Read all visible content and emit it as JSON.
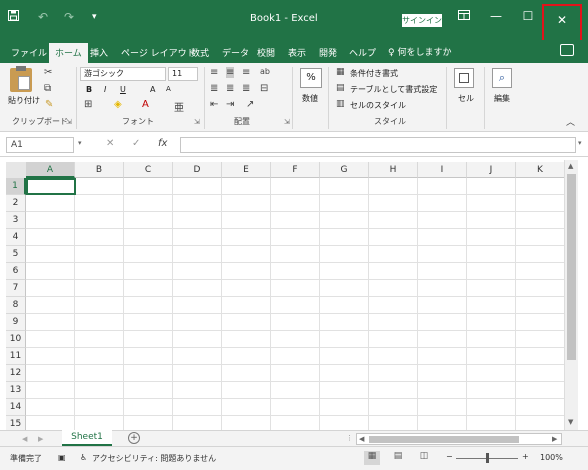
{
  "titlebar": {
    "title": "Book1  -  Excel",
    "signin": "サインイン",
    "save_icon": "save-icon",
    "undo_icon": "undo-icon",
    "redo_icon": "redo-icon",
    "customize_icon": "customize-qat-icon",
    "ribbon_display_icon": "ribbon-display-options-icon",
    "minimize": "—",
    "restore": "☐",
    "close": "✕"
  },
  "tabs": [
    {
      "label": "ファイル"
    },
    {
      "label": "ホーム"
    },
    {
      "label": "挿入"
    },
    {
      "label": "ページ レイアウト"
    },
    {
      "label": "数式"
    },
    {
      "label": "データ"
    },
    {
      "label": "校閲"
    },
    {
      "label": "表示"
    },
    {
      "label": "開発"
    },
    {
      "label": "ヘルプ"
    }
  ],
  "help_search": "何をしますか",
  "clipboard": {
    "paste": "貼り付け",
    "group": "クリップボード"
  },
  "font": {
    "name": "游ゴシック",
    "size": "11",
    "group": "フォント",
    "bold": "B",
    "italic": "I",
    "underline": "U",
    "grow": "A",
    "shrink": "A"
  },
  "alignment": {
    "group": "配置"
  },
  "number": {
    "percent": "%",
    "label": "数値"
  },
  "styles": {
    "conditional": "条件付き書式",
    "table": "テーブルとして書式設定",
    "cell_styles": "セルのスタイル",
    "group": "スタイル"
  },
  "cells": {
    "label": "セル"
  },
  "editing": {
    "label": "編集"
  },
  "formula_bar": {
    "namebox": "A1",
    "cancel": "✕",
    "enter": "✓",
    "fx": "fx"
  },
  "grid": {
    "columns": [
      "A",
      "B",
      "C",
      "D",
      "E",
      "F",
      "G",
      "H",
      "I",
      "J",
      "K"
    ],
    "rows": [
      "1",
      "2",
      "3",
      "4",
      "5",
      "6",
      "7",
      "8",
      "9",
      "10",
      "11",
      "12",
      "13",
      "14",
      "15"
    ]
  },
  "sheets": [
    {
      "label": "Sheet1"
    }
  ],
  "add_sheet": "+",
  "status": {
    "ready": "準備完了",
    "accessibility": "アクセシビリティ: 問題ありません",
    "zoom_minus": "−",
    "zoom_plus": "+",
    "zoom": "100%"
  },
  "colors": {
    "accent": "#217346",
    "close_highlight": "#e2121a"
  }
}
